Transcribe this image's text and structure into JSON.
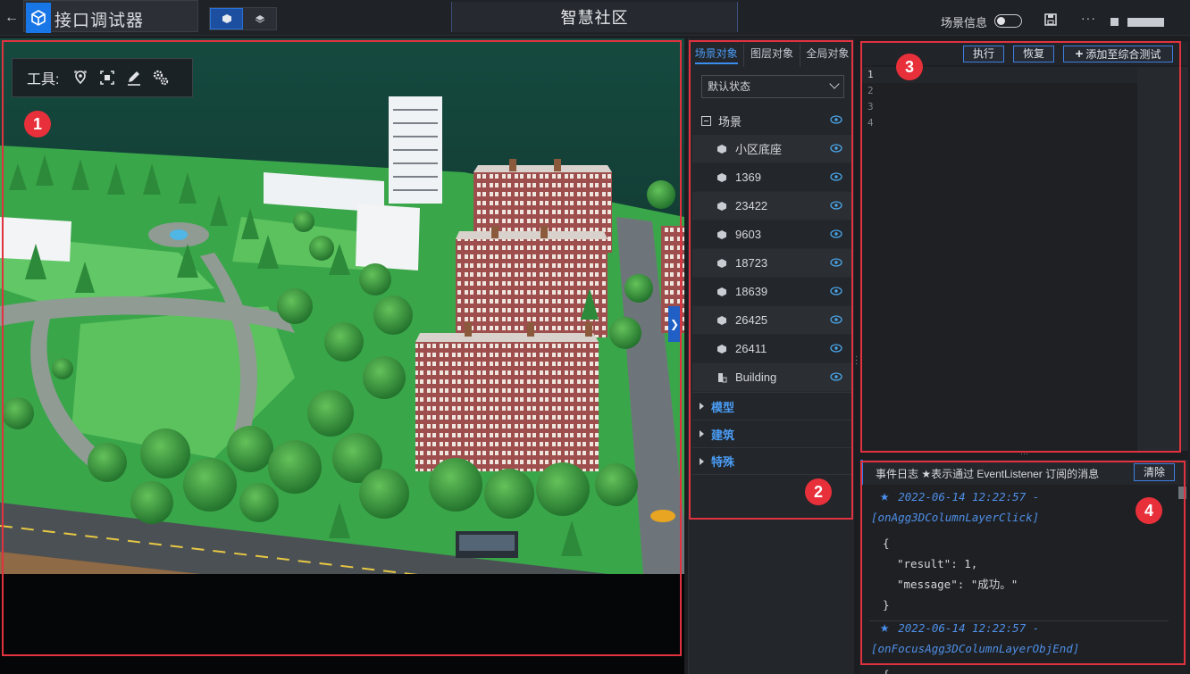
{
  "app": {
    "title": "接口调试器",
    "scene_title": "智慧社区",
    "scene_info_label": "场景信息",
    "scene_info_enabled": false,
    "more_label": "···"
  },
  "toolbox": {
    "label": "工具:",
    "tools": [
      "location-pin-icon",
      "focus-frame-icon",
      "pen-icon",
      "settings-gears-icon"
    ]
  },
  "panel": {
    "tabs": [
      "场景对象",
      "图层对象",
      "全局对象"
    ],
    "active_tab": 0,
    "state_select": "默认状态",
    "root_label": "场景",
    "items": [
      "小区底座",
      "1369",
      "23422",
      "9603",
      "18723",
      "18639",
      "26425",
      "26411",
      "Building"
    ],
    "groups": [
      "模型",
      "建筑",
      "特殊"
    ]
  },
  "editor": {
    "run_label": "执行",
    "restore_label": "恢复",
    "add_label": "添加至综合测试",
    "line_numbers": [
      "1",
      "2",
      "3",
      "4"
    ]
  },
  "log": {
    "title": "事件日志 ★表示通过 EventListener 订阅的消息",
    "clear_label": "清除",
    "entries": [
      {
        "time": "2022-06-14 12:22:57 -",
        "event": "[onAgg3DColumnLayerClick]",
        "lines": [
          "{",
          "\"result\": 1,",
          "\"message\": \"成功。\"",
          "}"
        ]
      },
      {
        "time": "2022-06-14 12:22:57 -",
        "event": "[onFocusAgg3DColumnLayerObjEnd]",
        "lines": [
          "{"
        ]
      }
    ]
  },
  "annotations": [
    "1",
    "2",
    "3",
    "4"
  ],
  "colors": {
    "accent": "#2f7ef0",
    "annotation_red": "#e0323f",
    "log_blue": "#4f8fe8"
  }
}
